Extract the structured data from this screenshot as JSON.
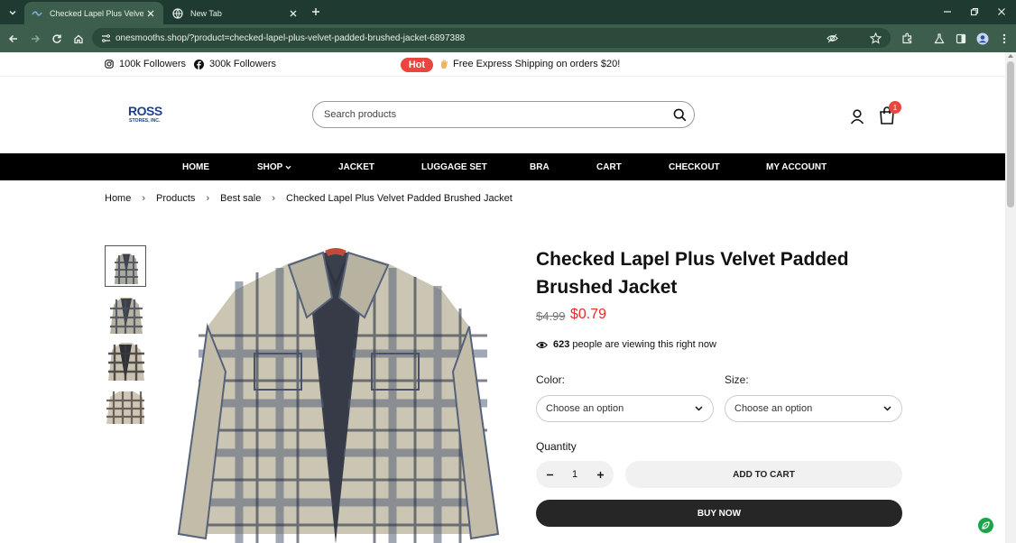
{
  "browser": {
    "tabs": [
      {
        "title": "Checked Lapel Plus Velvet Padd",
        "active": true
      },
      {
        "title": "New Tab",
        "active": false
      }
    ],
    "url": "onesmooths.shop/?product=checked-lapel-plus-velvet-padded-brushed-jacket-6897388",
    "accent": "#3d5e4c"
  },
  "topbar": {
    "instagram_followers": "100k Followers",
    "facebook_followers": "300k Followers",
    "hot_badge": "Hot",
    "promo": "Free Express Shipping on orders $20!"
  },
  "header": {
    "search_placeholder": "Search products",
    "cart_count": "1"
  },
  "nav": {
    "items": [
      "HOME",
      "SHOP",
      "JACKET",
      "LUGGAGE SET",
      "BRA",
      "CART",
      "CHECKOUT",
      "MY ACCOUNT"
    ]
  },
  "breadcrumb": [
    "Home",
    "Products",
    "Best sale",
    "Checked Lapel Plus Velvet Padded Brushed Jacket"
  ],
  "product": {
    "title": "Checked Lapel Plus Velvet Padded Brushed Jacket",
    "price_old": "$4.99",
    "price_new": "$0.79",
    "viewers_count": "623",
    "viewers_text": "people are viewing this right now",
    "color_label": "Color:",
    "size_label": "Size:",
    "color_value": "Choose an option",
    "size_value": "Choose an option",
    "quantity_label": "Quantity",
    "quantity": "1",
    "add_to_cart": "ADD TO CART",
    "buy_now": "BUY NOW",
    "price_color": "#e12c2c"
  }
}
